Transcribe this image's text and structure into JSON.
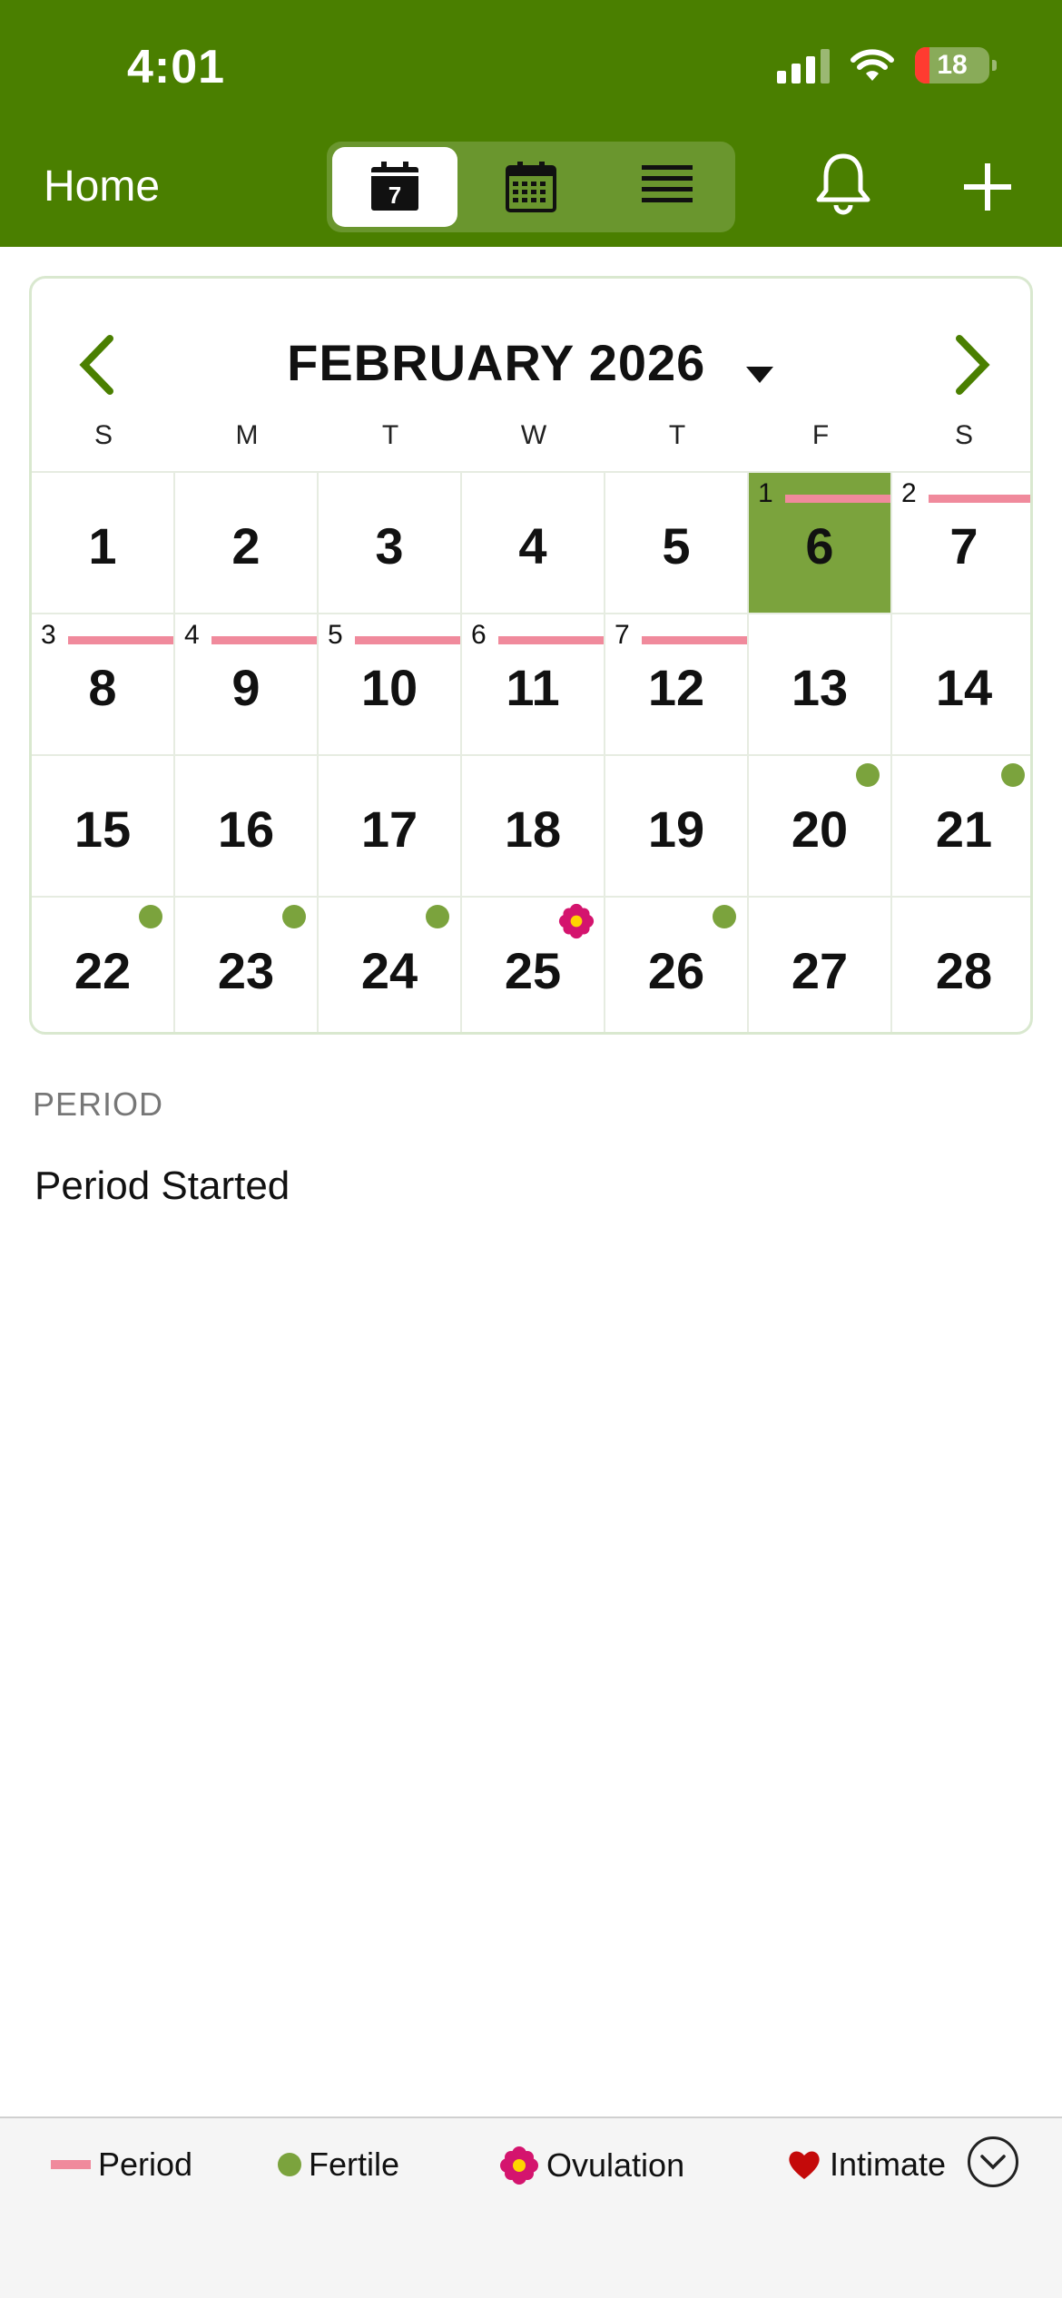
{
  "status": {
    "time": "4:01",
    "battery": "18"
  },
  "header": {
    "title": "Home",
    "view_modes": [
      "day-view",
      "month-view",
      "list-view"
    ],
    "active_view": "day-view",
    "day_icon_number": "7"
  },
  "calendar": {
    "month_label": "FEBRUARY 2026",
    "weekdays": [
      "S",
      "M",
      "T",
      "W",
      "T",
      "F",
      "S"
    ],
    "weeks": [
      [
        {
          "day": "1"
        },
        {
          "day": "2"
        },
        {
          "day": "3"
        },
        {
          "day": "4"
        },
        {
          "day": "5"
        },
        {
          "day": "6",
          "today": true,
          "period_day": "1"
        },
        {
          "day": "7",
          "period_day": "2"
        }
      ],
      [
        {
          "day": "8",
          "period_day": "3"
        },
        {
          "day": "9",
          "period_day": "4"
        },
        {
          "day": "10",
          "period_day": "5"
        },
        {
          "day": "11",
          "period_day": "6"
        },
        {
          "day": "12",
          "period_day": "7"
        },
        {
          "day": "13"
        },
        {
          "day": "14"
        }
      ],
      [
        {
          "day": "15"
        },
        {
          "day": "16"
        },
        {
          "day": "17"
        },
        {
          "day": "18"
        },
        {
          "day": "19"
        },
        {
          "day": "20",
          "fertile": true
        },
        {
          "day": "21",
          "fertile": true
        }
      ],
      [
        {
          "day": "22",
          "fertile": true
        },
        {
          "day": "23",
          "fertile": true
        },
        {
          "day": "24",
          "fertile": true
        },
        {
          "day": "25",
          "ovulation": true
        },
        {
          "day": "26",
          "fertile": true
        },
        {
          "day": "27"
        },
        {
          "day": "28"
        }
      ]
    ]
  },
  "details": {
    "section_label": "PERIOD",
    "entry": "Period Started"
  },
  "legend": {
    "period": "Period",
    "fertile": "Fertile",
    "ovulation": "Ovulation",
    "intimate": "Intimate"
  },
  "colors": {
    "header_green": "#4a7f00",
    "today_green": "#7ba33d",
    "period_pink": "#f08a9c",
    "fertile_green": "#7ba33d",
    "ovulation_magenta": "#d4146e",
    "intimate_red": "#c40a0a"
  }
}
